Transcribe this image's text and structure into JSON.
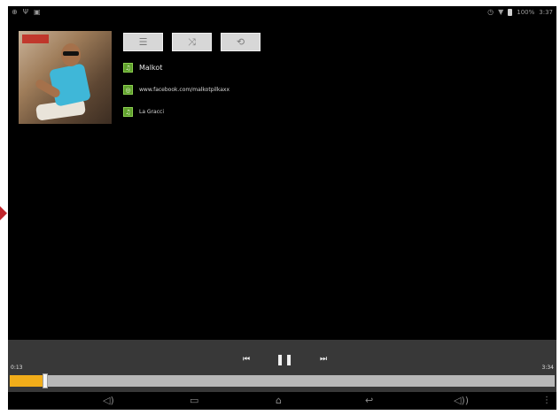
{
  "status_bar": {
    "left_icons": [
      "notification-icon",
      "signal-icon",
      "image-icon"
    ],
    "wifi": "wifi-icon",
    "battery_text": "100%",
    "time": "3:37"
  },
  "now_playing": {
    "artist": "Malkot",
    "url": "www.facebook.com/malkotpilkaxx",
    "album": "La Gracci"
  },
  "controls": {
    "list_icon": "list-icon",
    "shuffle_icon": "shuffle-icon",
    "repeat_icon": "repeat-icon"
  },
  "playback": {
    "current_time": "0:13",
    "total_time": "3:34",
    "progress": 0.065
  },
  "colors": {
    "accent": "#f1ad1a",
    "icon_green": "#5fa02c",
    "panel": "#383838"
  }
}
